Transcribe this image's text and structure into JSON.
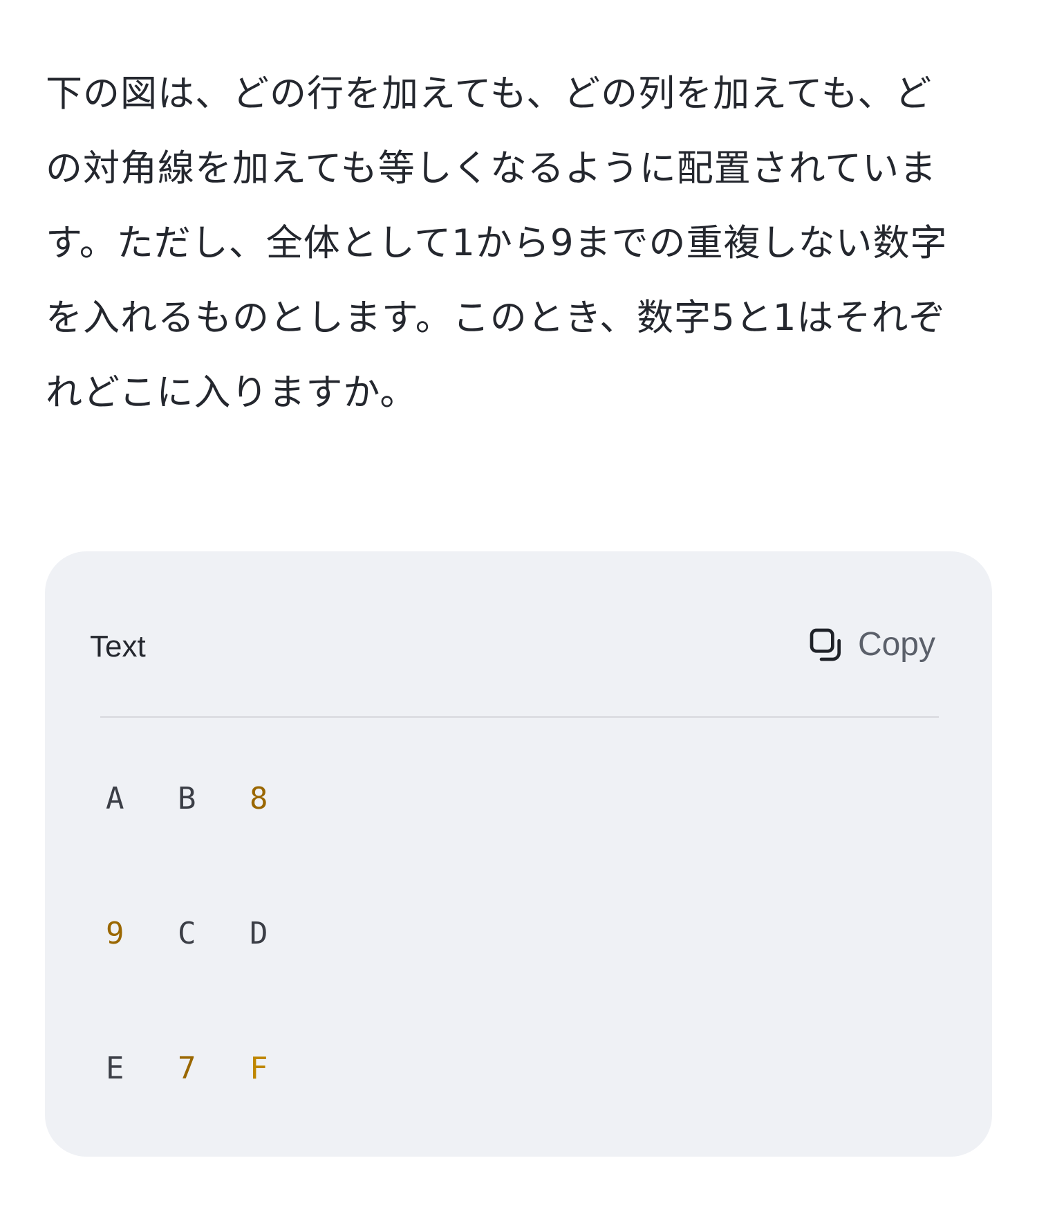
{
  "question": {
    "text": "下の図は、どの行を加えても、どの列を加えても、どの対角線を加えても等しくなるように配置されています。ただし、全体として1から9までの重複しない数字を入れるものとします。このとき、数字5と1はそれぞれどこに入りますか。"
  },
  "code_block": {
    "language_label": "Text",
    "copy_label": "Copy",
    "copy_icon": "copy-icon",
    "rows": [
      [
        {
          "text": "A",
          "kind": "letter"
        },
        {
          "text": "B",
          "kind": "letter"
        },
        {
          "text": "8",
          "kind": "num"
        }
      ],
      [
        {
          "text": "9",
          "kind": "num"
        },
        {
          "text": "C",
          "kind": "letter"
        },
        {
          "text": "D",
          "kind": "letter"
        }
      ],
      [
        {
          "text": "E",
          "kind": "letter"
        },
        {
          "text": "7",
          "kind": "num"
        },
        {
          "text": "F",
          "kind": "f"
        }
      ]
    ]
  },
  "colors": {
    "text": "#24272e",
    "card_bg": "#eff1f5",
    "number_highlight": "#9a6700",
    "f_highlight": "#bf8700",
    "copy_label": "#5b606a"
  }
}
